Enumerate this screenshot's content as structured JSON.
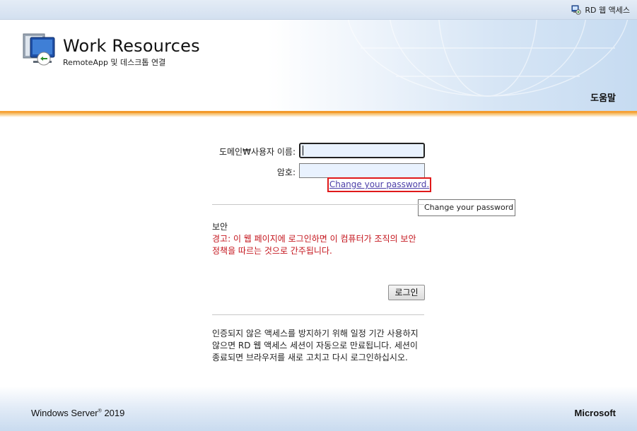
{
  "top_bar": {
    "rdweb_link": "RD 웹 액세스",
    "icon": "rd-web-access-icon"
  },
  "header": {
    "title": "Work Resources",
    "subtitle": "RemoteApp 및 데스크톱 연결",
    "help": "도움말",
    "logo_icon": "remote-desktop-monitor-icon"
  },
  "form": {
    "username_label": "도메인₩사용자 이름:",
    "username_value": "",
    "password_label": "암호:",
    "password_value": "",
    "change_password_link": "Change your password.",
    "tooltip": "Change your password",
    "security_heading": "보안",
    "security_warning": "경고: 이 웹 페이지에 로그인하면 이 컴퓨터가 조직의 보안 정책을 따르는 것으로 간주됩니다.",
    "login_button": "로그인",
    "timeout_notice": "인증되지 않은 액세스를 방지하기 위해 일정 기간 사용하지 않으면 RD 웹 액세스 세션이 자동으로 만료됩니다. 세션이 종료되면 브라우저를 새로 고치고 다시 로그인하십시오."
  },
  "footer": {
    "left": "Windows Server",
    "left_version": "2019",
    "right": "Microsoft"
  },
  "colors": {
    "accent_orange": "#f39a2a",
    "warning_red": "#c4141c",
    "link": "#4c3fa8",
    "input_bg": "#e9f2fe"
  }
}
